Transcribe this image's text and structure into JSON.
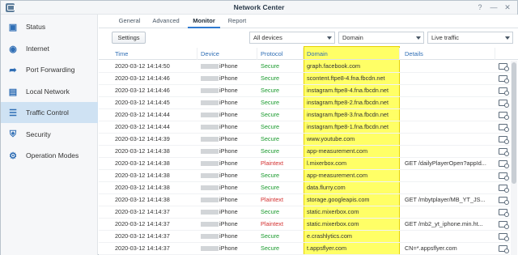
{
  "window": {
    "title": "Network Center"
  },
  "sidebar": {
    "items": [
      {
        "label": "Status",
        "icon": "monitor-icon"
      },
      {
        "label": "Internet",
        "icon": "globe-icon"
      },
      {
        "label": "Port Forwarding",
        "icon": "arrow-icon"
      },
      {
        "label": "Local Network",
        "icon": "network-icon"
      },
      {
        "label": "Traffic Control",
        "icon": "sliders-icon"
      },
      {
        "label": "Security",
        "icon": "shield-icon"
      },
      {
        "label": "Operation Modes",
        "icon": "gear-icon"
      }
    ],
    "active": "Traffic Control"
  },
  "tabs": [
    {
      "label": "General"
    },
    {
      "label": "Advanced"
    },
    {
      "label": "Monitor"
    },
    {
      "label": "Report"
    }
  ],
  "active_tab": "Monitor",
  "toolbar": {
    "settings_label": "Settings",
    "device_filter": "All devices",
    "group_filter": "Domain",
    "traffic_filter": "Live traffic"
  },
  "table": {
    "headers": {
      "time": "Time",
      "device": "Device",
      "protocol": "Protocol",
      "domain": "Domain",
      "details": "Details"
    },
    "rows": [
      {
        "time": "2020-03-12 14:14:50",
        "device": "iPhone",
        "protocol": "Secure",
        "domain": "graph.facebook.com",
        "details": ""
      },
      {
        "time": "2020-03-12 14:14:46",
        "device": "iPhone",
        "protocol": "Secure",
        "domain": "scontent.ftpe8-4.fna.fbcdn.net",
        "details": ""
      },
      {
        "time": "2020-03-12 14:14:46",
        "device": "iPhone",
        "protocol": "Secure",
        "domain": "instagram.ftpe8-4.fna.fbcdn.net",
        "details": ""
      },
      {
        "time": "2020-03-12 14:14:45",
        "device": "iPhone",
        "protocol": "Secure",
        "domain": "instagram.ftpe8-2.fna.fbcdn.net",
        "details": ""
      },
      {
        "time": "2020-03-12 14:14:44",
        "device": "iPhone",
        "protocol": "Secure",
        "domain": "instagram.ftpe8-3.fna.fbcdn.net",
        "details": ""
      },
      {
        "time": "2020-03-12 14:14:44",
        "device": "iPhone",
        "protocol": "Secure",
        "domain": "instagram.ftpe8-1.fna.fbcdn.net",
        "details": ""
      },
      {
        "time": "2020-03-12 14:14:39",
        "device": "iPhone",
        "protocol": "Secure",
        "domain": "www.youtube.com",
        "details": ""
      },
      {
        "time": "2020-03-12 14:14:38",
        "device": "iPhone",
        "protocol": "Secure",
        "domain": "app-measurement.com",
        "details": ""
      },
      {
        "time": "2020-03-12 14:14:38",
        "device": "iPhone",
        "protocol": "Plaintext",
        "domain": "l.mixerbox.com",
        "details": "GET /dailyPlayerOpen?appId..."
      },
      {
        "time": "2020-03-12 14:14:38",
        "device": "iPhone",
        "protocol": "Secure",
        "domain": "app-measurement.com",
        "details": ""
      },
      {
        "time": "2020-03-12 14:14:38",
        "device": "iPhone",
        "protocol": "Secure",
        "domain": "data.flurry.com",
        "details": ""
      },
      {
        "time": "2020-03-12 14:14:38",
        "device": "iPhone",
        "protocol": "Plaintext",
        "domain": "storage.googleapis.com",
        "details": "GET /mbytplayer/MB_YT_JS..."
      },
      {
        "time": "2020-03-12 14:14:37",
        "device": "iPhone",
        "protocol": "Secure",
        "domain": "static.mixerbox.com",
        "details": ""
      },
      {
        "time": "2020-03-12 14:14:37",
        "device": "iPhone",
        "protocol": "Plaintext",
        "domain": "static.mixerbox.com",
        "details": "GET /mb2_yt_iphone.min.ht..."
      },
      {
        "time": "2020-03-12 14:14:37",
        "device": "iPhone",
        "protocol": "Secure",
        "domain": "e.crashlytics.com",
        "details": ""
      },
      {
        "time": "2020-03-12 14:14:37",
        "device": "iPhone",
        "protocol": "Secure",
        "domain": "t.appsflyer.com",
        "details": "CN=*.appsflyer.com"
      }
    ]
  },
  "colors": {
    "secure": "#1a9a2e",
    "plaintext": "#d32f2f",
    "accent": "#2f6eb5",
    "highlight": "#ffff66"
  }
}
